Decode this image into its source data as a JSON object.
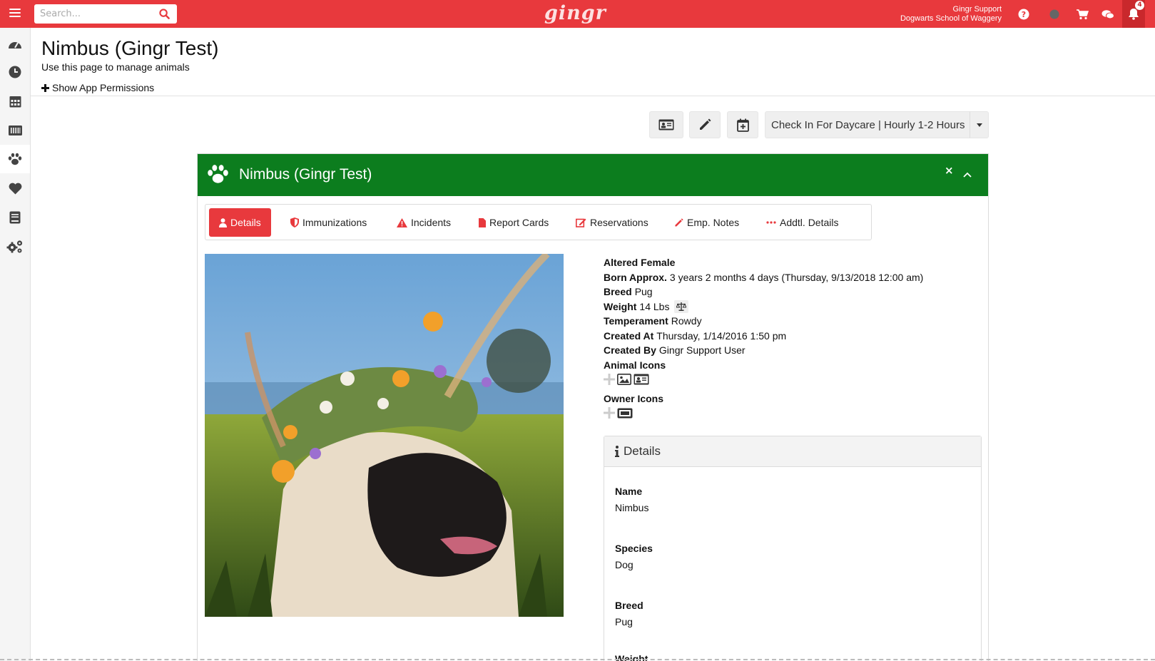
{
  "topbar": {
    "search_placeholder": "Search...",
    "logo": "gingr",
    "account_user": "Gingr Support",
    "account_location": "Dogwarts School of Waggery",
    "notification_count": "4"
  },
  "sidebar": {
    "items": [
      "dashboard-icon",
      "clock-icon",
      "calendar-icon",
      "barcode-icon",
      "paw-icon",
      "heart-icon",
      "book-icon",
      "gears-icon"
    ],
    "active": "paw-icon"
  },
  "header": {
    "title": "Nimbus (Gingr Test)",
    "subtitle": "Use this page to manage animals",
    "permissions_link": "Show App Permissions"
  },
  "toolbar": {
    "checkin_label": "Check In For Daycare | Hourly 1-2 Hours"
  },
  "panel": {
    "title": "Nimbus (Gingr Test)",
    "close_label": "×",
    "tabs": [
      {
        "label": "Details",
        "icon": "user-icon"
      },
      {
        "label": "Immunizations",
        "icon": "shield-icon"
      },
      {
        "label": "Incidents",
        "icon": "warning-icon"
      },
      {
        "label": "Report Cards",
        "icon": "file-icon"
      },
      {
        "label": "Reservations",
        "icon": "edit-icon"
      },
      {
        "label": "Emp. Notes",
        "icon": "pencil-icon"
      },
      {
        "label": "Addtl. Details",
        "icon": "ellipsis-icon"
      }
    ]
  },
  "animal": {
    "sex": "Altered Female",
    "born_label": "Born Approx.",
    "born_value": "3 years 2 months 4 days (Thursday, 9/13/2018 12:00 am)",
    "breed_label": "Breed",
    "breed_value": "Pug",
    "weight_label": "Weight",
    "weight_value": "14 Lbs",
    "temperament_label": "Temperament",
    "temperament_value": "Rowdy",
    "created_at_label": "Created At",
    "created_at_value": "Thursday, 1/14/2016 1:50 pm",
    "created_by_label": "Created By",
    "created_by_value": "Gingr Support User",
    "animal_icons_label": "Animal Icons",
    "owner_icons_label": "Owner Icons"
  },
  "details": {
    "heading": "Details",
    "fields": [
      {
        "label": "Name",
        "value": "Nimbus"
      },
      {
        "label": "Species",
        "value": "Dog"
      },
      {
        "label": "Breed",
        "value": "Pug"
      },
      {
        "label": "Weight",
        "value": ""
      }
    ]
  },
  "colors": {
    "brand_red": "#e8393d",
    "panel_green": "#0c7d1e"
  }
}
